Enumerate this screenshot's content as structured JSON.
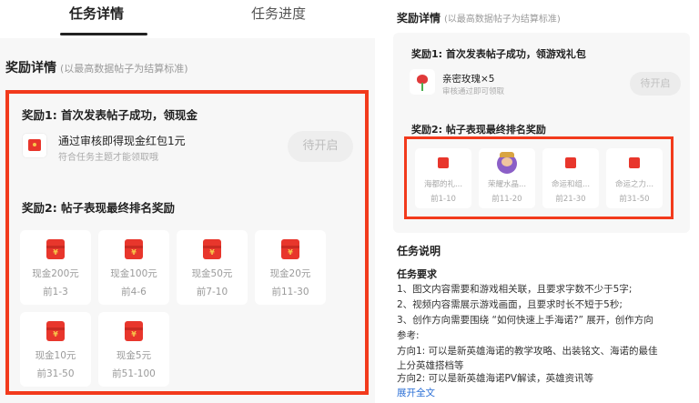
{
  "tabs": [
    {
      "label": "任务详情"
    },
    {
      "label": "任务进度"
    }
  ],
  "left": {
    "section_title": "奖励详情",
    "section_note": "(以最高数据帖子为结算标准)",
    "reward1": {
      "title": "奖励1:  首次发表帖子成功，领现金",
      "text": "通过审核即得现金红包1元",
      "sub": "符合任务主题才能领取哦",
      "button": "待开启"
    },
    "reward2": {
      "title": "奖励2:  帖子表现最终排名奖励",
      "cards": [
        {
          "amount": "现金200元",
          "rank": "前1-3"
        },
        {
          "amount": "现金100元",
          "rank": "前4-6"
        },
        {
          "amount": "现金50元",
          "rank": "前7-10"
        },
        {
          "amount": "现金20元",
          "rank": "前11-30"
        },
        {
          "amount": "现金10元",
          "rank": "前31-50"
        },
        {
          "amount": "现金5元",
          "rank": "前51-100"
        }
      ]
    }
  },
  "right": {
    "section_title": "奖励详情",
    "section_note": "(以最高数据帖子为结算标准)",
    "reward1": {
      "title": "奖励1:  首次发表帖子成功，领游戏礼包",
      "item": "亲密玫瑰×5",
      "sub": "审核通过即可领取",
      "button": "待开启"
    },
    "reward2": {
      "title": "奖励2:  帖子表现最终排名奖励",
      "cards": [
        {
          "name": "海都的礼...",
          "rank": "前1-10",
          "icon": "red-packet-icon"
        },
        {
          "name": "荣耀水晶...",
          "rank": "前11-20",
          "icon": "hero-skin-icon"
        },
        {
          "name": "命运和组...",
          "rank": "前21-30",
          "icon": "red-packet-icon"
        },
        {
          "name": "命运之力...",
          "rank": "前31-50",
          "icon": "red-packet-icon"
        }
      ]
    },
    "description": {
      "title": "任务说明",
      "req_title": "任务要求",
      "lines": [
        "1、图文内容需要和游戏相关联，且要求字数不少于5字;",
        "2、视频内容需展示游戏画面，且要求时长不短于5秒;",
        "3、创作方向需要围绕 “如何快速上手海诺?” 展开，创作方向",
        "参考:",
        "方向1:  可以是新英雄海诺的教学攻略、出装铭文、海诺的最佳",
        "上分英雄搭档等",
        "方向2:  可以是新英雄海诺PV解读，英雄资讯等"
      ],
      "expand": "展开全文"
    }
  },
  "colors": {
    "highlight_frame": "#f23a1c",
    "red_packet": "#e8362c",
    "link": "#2b6fd6"
  }
}
